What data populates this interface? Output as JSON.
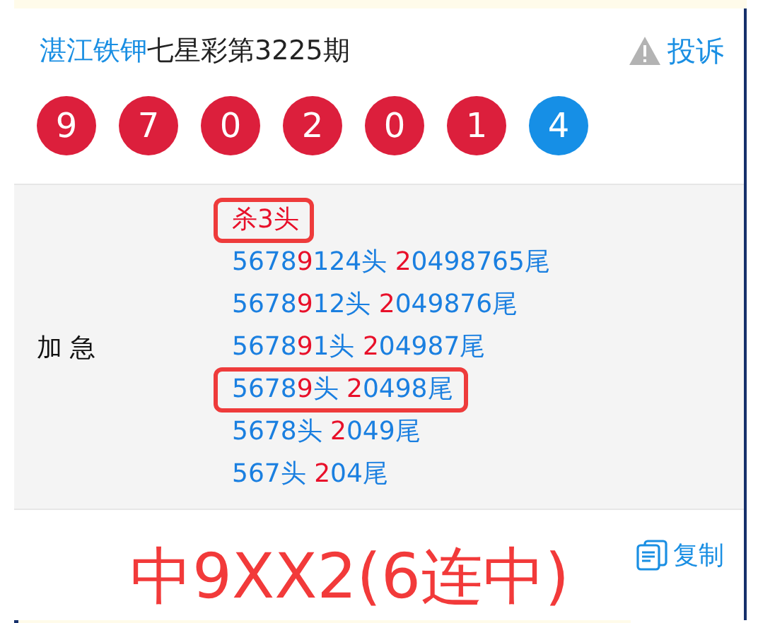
{
  "header": {
    "source": "湛江铁钾",
    "title": "七星彩第3225期",
    "report": "投诉"
  },
  "balls": [
    {
      "number": "9",
      "color": "#dc1f3c"
    },
    {
      "number": "7",
      "color": "#dc1f3c"
    },
    {
      "number": "0",
      "color": "#dc1f3c"
    },
    {
      "number": "2",
      "color": "#dc1f3c"
    },
    {
      "number": "0",
      "color": "#dc1f3c"
    },
    {
      "number": "1",
      "color": "#dc1f3c"
    },
    {
      "number": "4",
      "color": "#168fe6"
    }
  ],
  "prediction": {
    "label": "加 急",
    "lines": [
      {
        "boxed": true,
        "parts": [
          {
            "text": "杀3头",
            "red": true
          }
        ]
      },
      {
        "boxed": false,
        "parts": [
          {
            "text": "5678",
            "red": false
          },
          {
            "text": "9",
            "red": true
          },
          {
            "text": "124头 ",
            "red": false
          },
          {
            "text": "2",
            "red": true
          },
          {
            "text": "0498765尾",
            "red": false
          }
        ]
      },
      {
        "boxed": false,
        "parts": [
          {
            "text": "5678",
            "red": false
          },
          {
            "text": "9",
            "red": true
          },
          {
            "text": "12头 ",
            "red": false
          },
          {
            "text": "2",
            "red": true
          },
          {
            "text": "049876尾",
            "red": false
          }
        ]
      },
      {
        "boxed": false,
        "parts": [
          {
            "text": "5678",
            "red": false
          },
          {
            "text": "9",
            "red": true
          },
          {
            "text": "1头 ",
            "red": false
          },
          {
            "text": "2",
            "red": true
          },
          {
            "text": "04987尾",
            "red": false
          }
        ]
      },
      {
        "boxed": true,
        "parts": [
          {
            "text": "5678",
            "red": false
          },
          {
            "text": "9",
            "red": true
          },
          {
            "text": "头 ",
            "red": false
          },
          {
            "text": "2",
            "red": true
          },
          {
            "text": "0498尾",
            "red": false
          }
        ]
      },
      {
        "boxed": false,
        "parts": [
          {
            "text": "5678头 ",
            "red": false
          },
          {
            "text": "2",
            "red": true
          },
          {
            "text": "049尾",
            "red": false
          }
        ]
      },
      {
        "boxed": false,
        "parts": [
          {
            "text": "567头 ",
            "red": false
          },
          {
            "text": "2",
            "red": true
          },
          {
            "text": "04尾",
            "red": false
          }
        ]
      }
    ]
  },
  "copy": "复制",
  "annotation": "中9XX2(6连中)"
}
